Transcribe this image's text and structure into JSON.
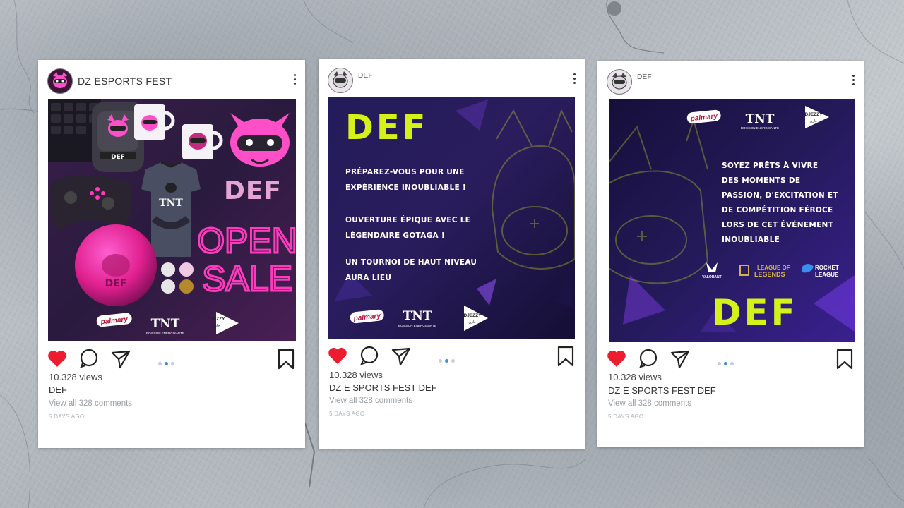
{
  "colors": {
    "brand_green": "#d4f21a",
    "heart": "#ed1c2e",
    "dot_active": "#3d8fe0",
    "neon_pink": "#ff3bbd"
  },
  "posts": [
    {
      "username": "DZ ESPORTS FEST",
      "image": {
        "brand_text": "DEF",
        "open_label": "OPEN",
        "sale_label": "SALE",
        "sponsors": [
          "palmary",
          "TNT",
          "DJEZZY"
        ],
        "sponsor_tagline": "BOISSON ENERGISANTE",
        "djezzy_arabic": "جازي"
      },
      "views": "10.328 views",
      "caption": "DEF",
      "comments": "View all 328 comments",
      "ago": "5 DAYS AGO"
    },
    {
      "username": "DEF",
      "image": {
        "logo": "DEF",
        "lines": [
          "PRÉPAREZ-VOUS POUR UNE",
          "EXPÉRIENCE INOUBLIABLE !",
          "OUVERTURE ÉPIQUE AVEC LE",
          "LÉGENDAIRE GOTAGA !",
          "UN TOURNOI DE HAUT NIVEAU",
          "AURA LIEU"
        ],
        "sponsors": [
          "palmary",
          "TNT",
          "DJEZZY"
        ],
        "sponsor_tagline": "BOISSON ENERGISANTE",
        "djezzy_arabic": "جازي"
      },
      "views": "10.328 views",
      "caption": "DZ E SPORTS FEST DEF",
      "comments": "View all 328 comments",
      "ago": "5 DAYS AGO"
    },
    {
      "username": "DEF",
      "image": {
        "logo": "DEF",
        "lines": [
          "SOYEZ PRÊTS À VIVRE",
          "DES MOMENTS DE",
          "PASSION, D'EXCITATION ET",
          "DE COMPÉTITION FÉROCE",
          "LORS DE CET ÉVÉNEMENT",
          "INOUBLIABLE"
        ],
        "games": [
          "VALORANT",
          "LEAGUE OF",
          "LEGENDS",
          "ROCKET",
          "LEAGUE"
        ],
        "sponsors": [
          "palmary",
          "TNT",
          "DJEZZY"
        ],
        "sponsor_tagline": "BOISSON ENERGISANTE",
        "djezzy_arabic": "جازي"
      },
      "views": "10.328 views",
      "caption": "DZ E SPORTS FEST DEF",
      "comments": "View all 328 comments",
      "ago": "5 DAYS AGO"
    }
  ]
}
